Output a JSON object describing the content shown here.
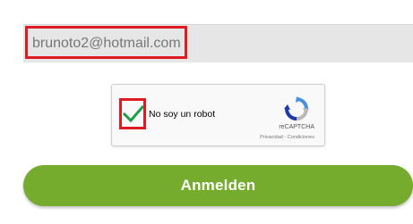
{
  "form": {
    "email_value": "brunoto2@hotmail.com",
    "submit_label": "Anmelden"
  },
  "captcha": {
    "checked": true,
    "label": "No soy un robot",
    "brand": "reCAPTCHA",
    "links": "Privacidad - Condiciones"
  },
  "colors": {
    "highlight": "#e01a22",
    "button": "#75ac2d",
    "checkmark": "#1e9e48"
  },
  "icons": {
    "checkmark": "checkmark-icon",
    "recaptcha": "recaptcha-logo-icon"
  }
}
